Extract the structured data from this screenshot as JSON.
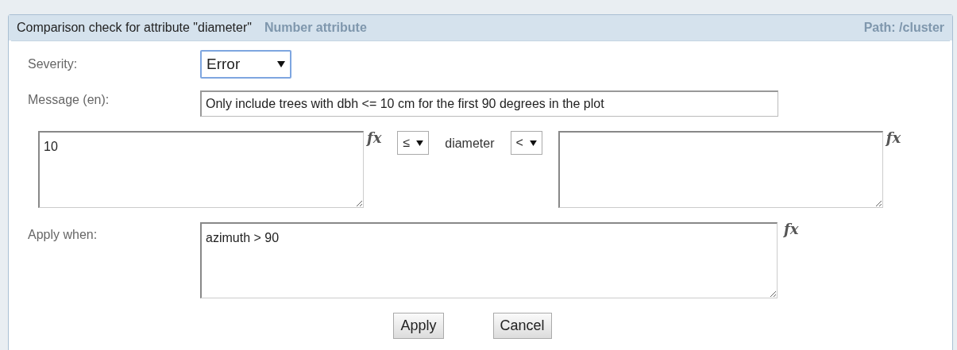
{
  "background": {
    "heading": "Number attribute",
    "path": "Path: /cluster"
  },
  "dialog": {
    "title": "Comparison check for attribute \"diameter\""
  },
  "severity": {
    "label": "Severity:",
    "value": "Error"
  },
  "message": {
    "label": "Message (en):",
    "value": "Only include trees with dbh <= 10 cm for the first 90 degrees in the plot"
  },
  "comparison": {
    "left_value": "10",
    "left_formula": "fx",
    "left_operator": "≤",
    "attribute": "diameter",
    "right_operator": "<",
    "right_formula": "fx"
  },
  "apply_when": {
    "label": "Apply when:",
    "value": "azimuth > 90",
    "formula": "fx"
  },
  "buttons": [
    "Apply",
    "Cancel"
  ]
}
